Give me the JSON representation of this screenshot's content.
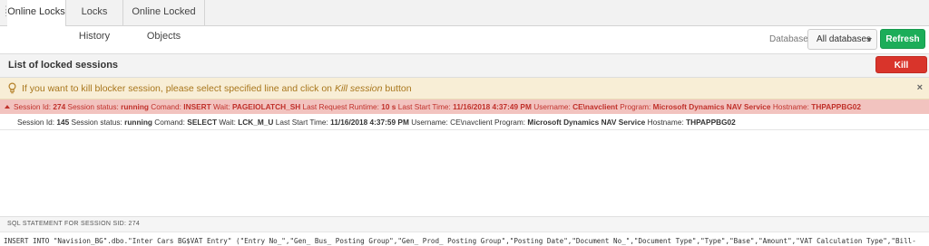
{
  "tabs": [
    {
      "label": "Online Locks",
      "active": true
    },
    {
      "label": "Locks History",
      "active": false
    },
    {
      "label": "Online Locked Objects",
      "active": false
    }
  ],
  "toolbar": {
    "database_label": "Database:",
    "database_value": "All databases",
    "refresh_label": "Refresh"
  },
  "panel": {
    "title": "List of locked sessions",
    "kill_label": "Kill session"
  },
  "alert": {
    "text_before": "If you want to kill blocker session, please select specified line and click on ",
    "text_italic": "Kill session",
    "text_after": " button",
    "close": "×"
  },
  "sessions": [
    {
      "session_id": "274",
      "status": "running",
      "command": "INSERT",
      "wait": "PAGEIOLATCH_SH",
      "runtime": "10 s",
      "start_time": "11/16/2018 4:37:49 PM",
      "username": "CE\\navclient",
      "program": "Microsoft Dynamics NAV Service",
      "hostname": "THPAPPBG02"
    },
    {
      "session_id": "145",
      "status": "running",
      "command": "SELECT",
      "wait": "LCK_M_U",
      "start_time": "11/16/2018 4:37:59 PM",
      "username": "CE\\navclient",
      "program": "Microsoft Dynamics NAV Service",
      "hostname": "THPAPPBG02"
    }
  ],
  "labels": {
    "session_id": "Session Id:",
    "status": "Session status:",
    "command": "Comand:",
    "wait": "Wait:",
    "runtime": "Last Request Runtime:",
    "start_time": "Last Start Time:",
    "username": "Username:",
    "program": "Program:",
    "hostname": "Hostname:"
  },
  "sql": {
    "header": "SQL STATEMENT FOR SESSION SID: 274",
    "statement": "INSERT INTO \"Navision_BG\".dbo.\"Inter Cars BG$VAT Entry\" (\"Entry No_\",\"Gen_ Bus_ Posting Group\",\"Gen_ Prod_ Posting Group\",\"Posting Date\",\"Document No_\",\"Document Type\",\"Type\",\"Base\",\"Amount\",\"VAT Calculation Type\",\"Bill-"
  }
}
